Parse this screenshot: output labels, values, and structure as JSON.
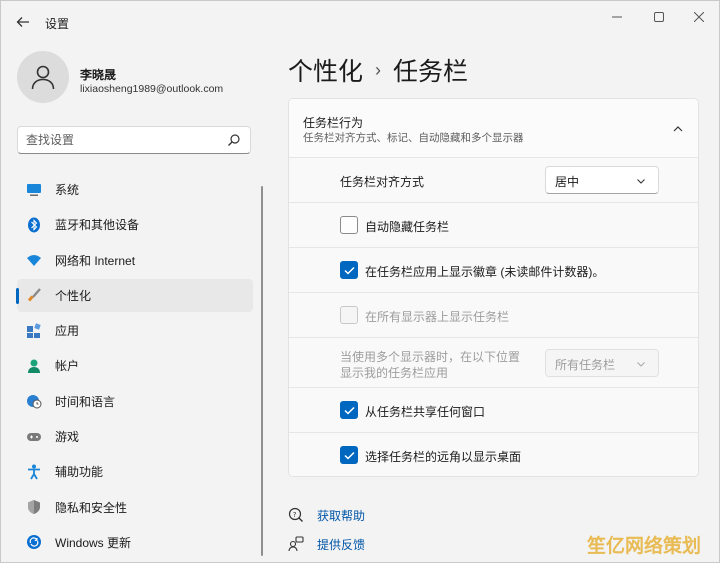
{
  "window": {
    "title": "设置"
  },
  "user": {
    "name": "李晓晟",
    "email": "lixiaosheng1989@outlook.com"
  },
  "search": {
    "placeholder": "查找设置"
  },
  "sidebar": {
    "items": [
      {
        "label": "系统",
        "icon": "monitor-icon"
      },
      {
        "label": "蓝牙和其他设备",
        "icon": "bluetooth-icon"
      },
      {
        "label": "网络和 Internet",
        "icon": "wifi-icon"
      },
      {
        "label": "个性化",
        "icon": "brush-icon",
        "active": true
      },
      {
        "label": "应用",
        "icon": "apps-icon"
      },
      {
        "label": "帐户",
        "icon": "person-icon"
      },
      {
        "label": "时间和语言",
        "icon": "globe-clock-icon"
      },
      {
        "label": "游戏",
        "icon": "gamepad-icon"
      },
      {
        "label": "辅助功能",
        "icon": "accessibility-icon"
      },
      {
        "label": "隐私和安全性",
        "icon": "shield-icon"
      },
      {
        "label": "Windows 更新",
        "icon": "update-icon"
      }
    ]
  },
  "breadcrumb": {
    "parent": "个性化",
    "separator": "›",
    "current": "任务栏"
  },
  "section": {
    "title": "任务栏行为",
    "subtitle": "任务栏对齐方式、标记、自动隐藏和多个显示器",
    "alignment": {
      "label": "任务栏对齐方式",
      "value": "居中"
    },
    "auto_hide": {
      "label": "自动隐藏任务栏",
      "checked": false
    },
    "badges": {
      "label": "在任务栏应用上显示徽章 (未读邮件计数器)。",
      "checked": true
    },
    "all_displays": {
      "label": "在所有显示器上显示任务栏",
      "checked": false,
      "disabled": true
    },
    "multi_display": {
      "label_line1": "当使用多个显示器时，在以下位置",
      "label_line2": "显示我的任务栏应用",
      "value": "所有任务栏",
      "disabled": true
    },
    "share_window": {
      "label": "从任务栏共享任何窗口",
      "checked": true
    },
    "far_corner": {
      "label": "选择任务栏的远角以显示桌面",
      "checked": true
    }
  },
  "links": {
    "help": "获取帮助",
    "feedback": "提供反馈"
  },
  "watermark": {
    "text": "笙亿网络策划"
  },
  "colors": {
    "accent": "#0067c0",
    "link": "#0056a8"
  }
}
